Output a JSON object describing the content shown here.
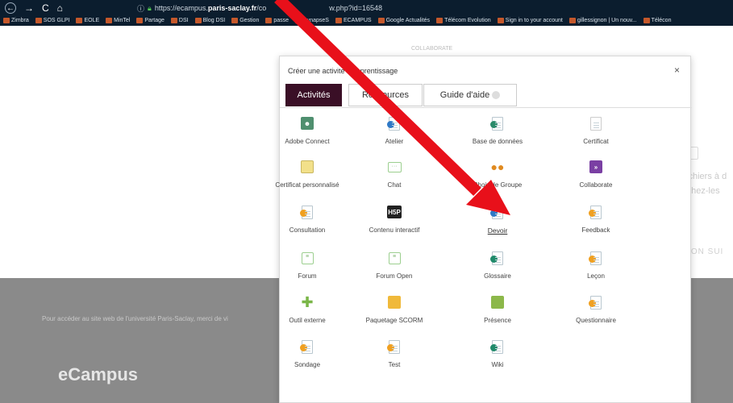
{
  "browser": {
    "url_prefix": "https://ecampus.",
    "url_domain": "paris-saclay.fr",
    "url_suffix": "/co",
    "url_tail": "w.php?id=16548",
    "bookmarks": [
      "Zimbra",
      "SOS GLPI",
      "EOLE",
      "MinTel",
      "Partage",
      "DSI",
      "Blog DSI",
      "Gestion",
      "passe",
      "SynapseS",
      "ECAMPUS",
      "Google Actualités",
      "Télécom Evolution",
      "Sign in to your account",
      "gillessignon | Un nouv...",
      "Télécon"
    ]
  },
  "background": {
    "top_label": "COLLABORATE",
    "footer_text": "Pour accéder au site web de l'université Paris-Saclay, merci de vi",
    "brand": "eCampus",
    "right_text_1": "fichiers à d",
    "right_text_2": "rchez-les",
    "right_text_3": "TION SUI"
  },
  "modal": {
    "title": "Créer une activité d'apprentissage",
    "close": "×",
    "tabs": {
      "activites": "Activités",
      "ressources": "Ressources",
      "guide": "Guide d'aide"
    },
    "items": [
      {
        "label": "Adobe Connect",
        "icon": "adobe-connect-icon"
      },
      {
        "label": "Atelier",
        "icon": "workshop-icon"
      },
      {
        "label": "Base de données",
        "icon": "database-icon"
      },
      {
        "label": "Certificat",
        "icon": "certificate-icon"
      },
      {
        "label": "Certificat personnalisé",
        "icon": "custom-certificate-icon"
      },
      {
        "label": "Chat",
        "icon": "chat-icon"
      },
      {
        "label": "Choix de Groupe",
        "icon": "group-choice-icon"
      },
      {
        "label": "Collaborate",
        "icon": "collaborate-icon"
      },
      {
        "label": "Consultation",
        "icon": "consultation-icon"
      },
      {
        "label": "Contenu interactif",
        "icon": "h5p-icon"
      },
      {
        "label": "Devoir",
        "icon": "assignment-icon"
      },
      {
        "label": "Feedback",
        "icon": "feedback-icon"
      },
      {
        "label": "Forum",
        "icon": "forum-icon"
      },
      {
        "label": "Forum Open",
        "icon": "forum-open-icon"
      },
      {
        "label": "Glossaire",
        "icon": "glossary-icon"
      },
      {
        "label": "Leçon",
        "icon": "lesson-icon"
      },
      {
        "label": "Outil externe",
        "icon": "puzzle-icon"
      },
      {
        "label": "Paquetage SCORM",
        "icon": "scorm-package-icon"
      },
      {
        "label": "Présence",
        "icon": "attendance-icon"
      },
      {
        "label": "Questionnaire",
        "icon": "questionnaire-icon"
      },
      {
        "label": "Sondage",
        "icon": "survey-icon"
      },
      {
        "label": "Test",
        "icon": "quiz-icon"
      },
      {
        "label": "Wiki",
        "icon": "wiki-icon"
      }
    ],
    "h5p_text": "H5P"
  },
  "colors": {
    "tab_active": "#3a0f26",
    "arrow": "#e8101a",
    "footer_bg": "#8a8a8a",
    "chrome_bg": "#0b1d2e"
  }
}
